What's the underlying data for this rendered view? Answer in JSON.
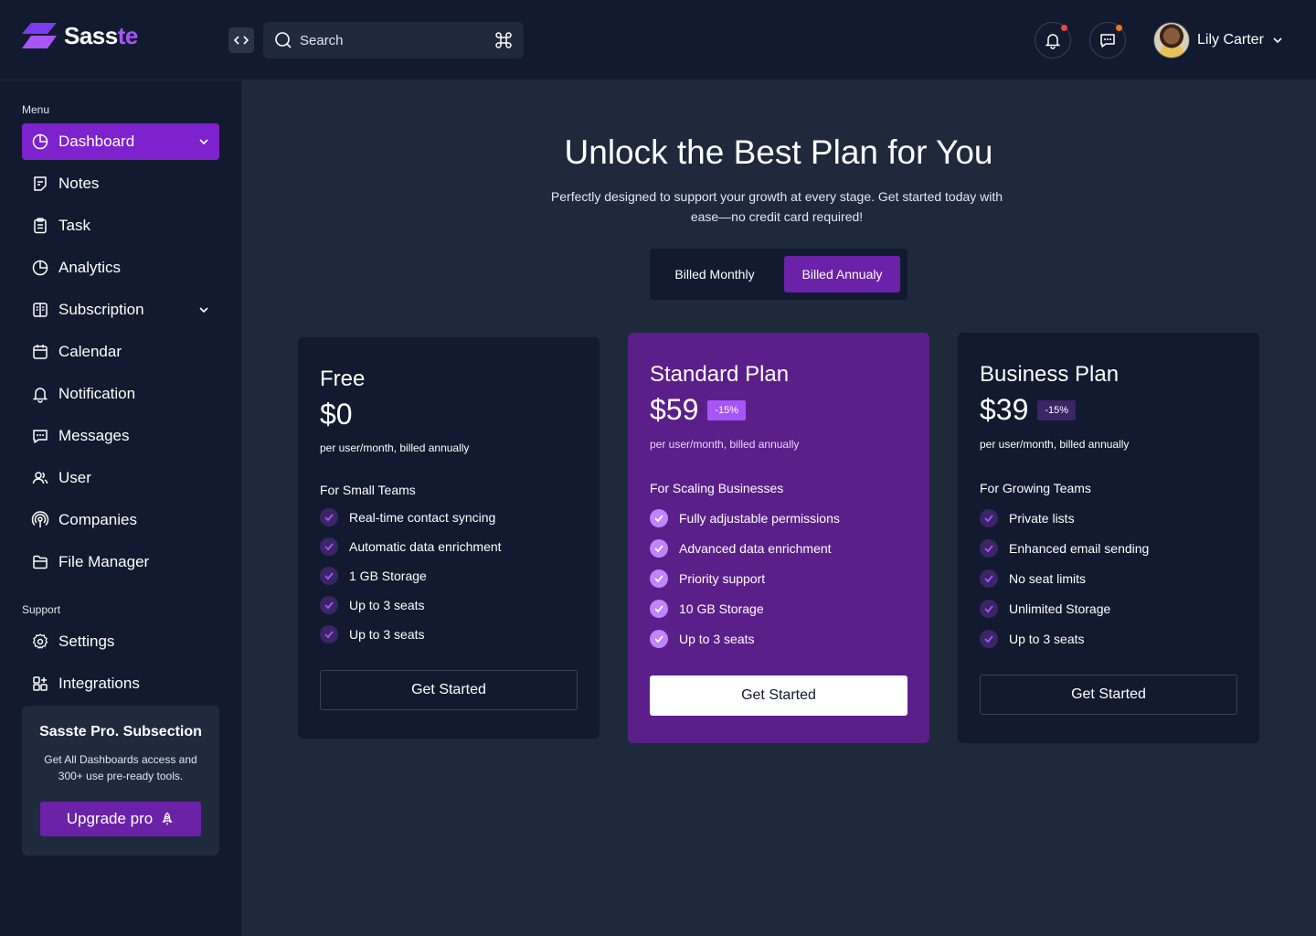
{
  "app": {
    "name_part1": "Sass",
    "name_part2": "te",
    "brand_color": "#7e22ce"
  },
  "header": {
    "search_placeholder": "Search",
    "user_name": "Lily Carter",
    "icons": [
      "code-toggle-icon",
      "search-icon",
      "command-icon",
      "bell-icon",
      "chat-icon",
      "chevron-down-icon"
    ]
  },
  "sidebar": {
    "menu_label": "Menu",
    "items": [
      {
        "label": "Dashboard",
        "icon": "pie-chart-icon",
        "active": true,
        "has_chevron": true
      },
      {
        "label": "Notes",
        "icon": "note-icon"
      },
      {
        "label": "Task",
        "icon": "clipboard-icon"
      },
      {
        "label": "Analytics",
        "icon": "pie-chart-icon"
      },
      {
        "label": "Subscription",
        "icon": "grid-book-icon",
        "has_chevron": true
      },
      {
        "label": "Calendar",
        "icon": "calendar-icon"
      },
      {
        "label": "Notification",
        "icon": "bell-icon"
      },
      {
        "label": "Messages",
        "icon": "chat-icon"
      },
      {
        "label": "User",
        "icon": "users-icon"
      },
      {
        "label": "Companies",
        "icon": "broadcast-icon"
      },
      {
        "label": "File Manager",
        "icon": "folder-icon"
      }
    ],
    "support_label": "Support",
    "support_items": [
      {
        "label": "Settings",
        "icon": "gear-icon"
      },
      {
        "label": "Integrations",
        "icon": "apps-icon"
      }
    ],
    "promo": {
      "title": "Sasste Pro. Subsection",
      "text": "Get All Dashboards access and 300+ use pre-ready tools.",
      "button": "Upgrade pro"
    }
  },
  "main": {
    "title": "Unlock the Best Plan for You",
    "subtitle": "Perfectly designed to support your growth at every stage. Get started today with ease—no credit card required!",
    "billing": {
      "monthly": "Billed Monthly",
      "annual": "Billed Annualy",
      "selected": "annual"
    },
    "plans": [
      {
        "name": "Free",
        "price": "$0",
        "discount": "",
        "period": "per user/month, billed annually",
        "audience": "For Small Teams",
        "features": [
          "Real-time contact syncing",
          "Automatic data enrichment",
          "1 GB Storage",
          "Up to 3 seats",
          "Up to 3 seats"
        ],
        "cta": "Get Started"
      },
      {
        "name": "Standard Plan",
        "price": "$59",
        "discount": "-15%",
        "period": "per user/month, billed annually",
        "audience": "For Scaling Businesses",
        "features": [
          "Fully adjustable permissions",
          "Advanced data enrichment",
          "Priority support",
          "10 GB Storage",
          "Up to 3 seats"
        ],
        "cta": "Get Started",
        "highlighted": true
      },
      {
        "name": "Business Plan",
        "price": "$39",
        "discount": "-15%",
        "period": "per user/month, billed annually",
        "audience": "For Growing Teams",
        "features": [
          "Private lists",
          "Enhanced email sending",
          "No seat limits",
          "Unlimited Storage",
          "Up to 3 seats"
        ],
        "cta": "Get Started"
      }
    ]
  }
}
